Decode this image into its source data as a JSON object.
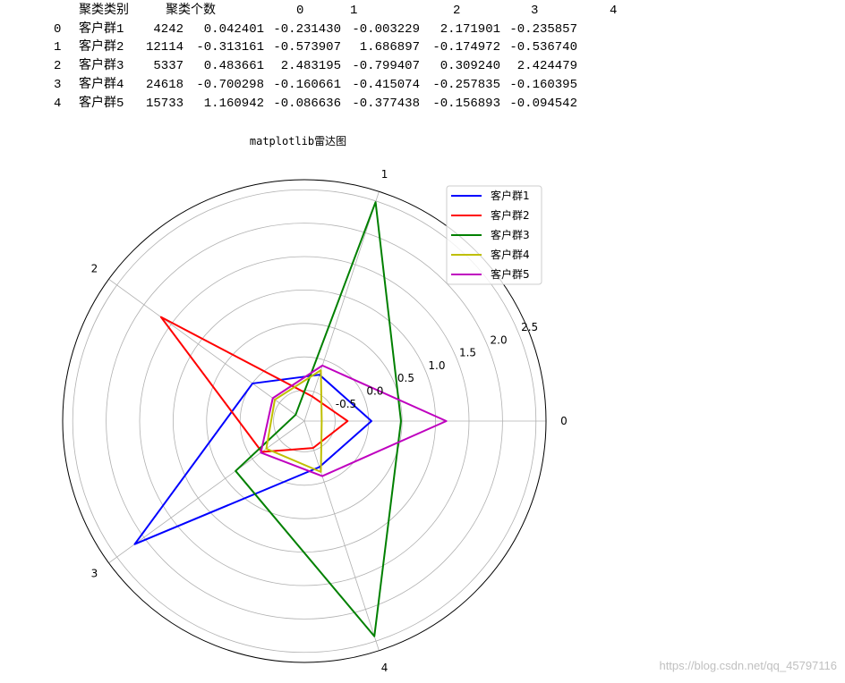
{
  "dataframe": {
    "columns": [
      "聚类类别",
      "聚类个数",
      "0",
      "1",
      "2",
      "3",
      "4"
    ],
    "rows": [
      {
        "index": "0",
        "cells": [
          "客户群1",
          "4242",
          "0.042401",
          "-0.231430",
          "-0.003229",
          "2.171901",
          "-0.235857"
        ]
      },
      {
        "index": "1",
        "cells": [
          "客户群2",
          "12114",
          "-0.313161",
          "-0.573907",
          "1.686897",
          "-0.174972",
          "-0.536740"
        ]
      },
      {
        "index": "2",
        "cells": [
          "客户群3",
          "5337",
          "0.483661",
          "2.483195",
          "-0.799407",
          "0.309240",
          "2.424479"
        ]
      },
      {
        "index": "3",
        "cells": [
          "客户群4",
          "24618",
          "-0.700298",
          "-0.160661",
          "-0.415074",
          "-0.257835",
          "-0.160395"
        ]
      },
      {
        "index": "4",
        "cells": [
          "客户群5",
          "15733",
          "1.160942",
          "-0.086636",
          "-0.377438",
          "-0.156893",
          "-0.094542"
        ]
      }
    ]
  },
  "chart_data": {
    "type": "line",
    "projection": "polar",
    "title": "matplotlib雷达图",
    "categories": [
      "0",
      "1",
      "2",
      "3",
      "4"
    ],
    "rticks": [
      -0.5,
      0.0,
      0.5,
      1.0,
      1.5,
      2.0,
      2.5
    ],
    "rtick_labels": [
      "-0.5",
      "0.0",
      "0.5",
      "1.0",
      "1.5",
      "2.0",
      "2.5"
    ],
    "rlim": [
      -0.96,
      2.65
    ],
    "grid": true,
    "legend_position": "upper right",
    "series": [
      {
        "name": "客户群1",
        "color": "#0000ff",
        "values": [
          0.042401,
          -0.23143,
          -0.003229,
          2.171901,
          -0.235857
        ]
      },
      {
        "name": "客户群2",
        "color": "#ff0000",
        "values": [
          -0.313161,
          -0.573907,
          1.686897,
          -0.174972,
          -0.53674
        ]
      },
      {
        "name": "客户群3",
        "color": "#008000",
        "values": [
          0.483661,
          2.483195,
          -0.799407,
          0.30924,
          2.424479
        ]
      },
      {
        "name": "客户群4",
        "color": "#bfbf00",
        "values": [
          -0.700298,
          -0.160661,
          -0.415074,
          -0.257835,
          -0.160395
        ]
      },
      {
        "name": "客户群5",
        "color": "#bf00bf",
        "values": [
          1.160942,
          -0.086636,
          -0.377438,
          -0.156893,
          -0.094542
        ]
      }
    ]
  },
  "watermark": "https://blog.csdn.net/qq_45797116"
}
